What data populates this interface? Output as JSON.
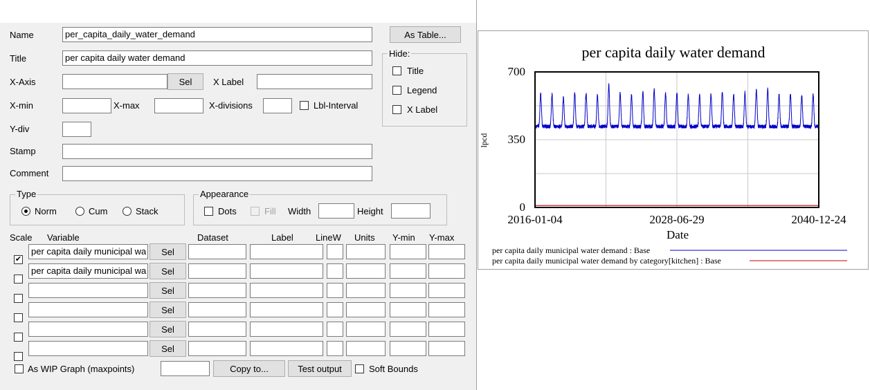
{
  "form": {
    "name_label": "Name",
    "name_value": "per_capita_daily_water_demand",
    "title_label": "Title",
    "title_value": "per capita daily water demand",
    "xaxis_label": "X-Axis",
    "xaxis_value": "",
    "sel_label": "Sel",
    "xlabel_label": "X Label",
    "xlabel_value": "",
    "xmin_label": "X-min",
    "xmin_value": "",
    "xmax_label": "X-max",
    "xmax_value": "",
    "xdiv_label": "X-divisions",
    "xdiv_value": "",
    "lbl_interval_label": "Lbl-Interval",
    "ydiv_label": "Y-div",
    "ydiv_value": "",
    "stamp_label": "Stamp",
    "stamp_value": "",
    "comment_label": "Comment",
    "comment_value": "",
    "as_table_label": "As Table...",
    "hide": {
      "title": "Hide:",
      "options": [
        "Title",
        "Legend",
        "X Label"
      ]
    },
    "type_group": {
      "title": "Type",
      "options": [
        "Norm",
        "Cum",
        "Stack"
      ],
      "selected": "Norm"
    },
    "appearance": {
      "title": "Appearance",
      "dots_label": "Dots",
      "fill_label": "Fill",
      "width_label": "Width",
      "width_value": "",
      "height_label": "Height",
      "height_value": ""
    },
    "columns": [
      "Scale",
      "Variable",
      "Dataset",
      "Label",
      "LineW",
      "Units",
      "Y-min",
      "Y-max"
    ],
    "rows": [
      {
        "checked": true,
        "variable": "per capita daily municipal wa",
        "dataset": "",
        "label": "",
        "linew": "",
        "units": "",
        "ymin": "",
        "ymax": ""
      },
      {
        "checked": false,
        "variable": "per capita daily municipal wa",
        "dataset": "",
        "label": "",
        "linew": "",
        "units": "",
        "ymin": "",
        "ymax": ""
      },
      {
        "checked": false,
        "variable": "",
        "dataset": "",
        "label": "",
        "linew": "",
        "units": "",
        "ymin": "",
        "ymax": ""
      },
      {
        "checked": false,
        "variable": "",
        "dataset": "",
        "label": "",
        "linew": "",
        "units": "",
        "ymin": "",
        "ymax": ""
      },
      {
        "checked": false,
        "variable": "",
        "dataset": "",
        "label": "",
        "linew": "",
        "units": "",
        "ymin": "",
        "ymax": ""
      },
      {
        "checked": false,
        "variable": "",
        "dataset": "",
        "label": "",
        "linew": "",
        "units": "",
        "ymin": "",
        "ymax": ""
      }
    ],
    "wip_label": "As WIP Graph (maxpoints)",
    "wip_value": "",
    "copy_to_label": "Copy to...",
    "test_output_label": "Test output",
    "soft_bounds_label": "Soft Bounds"
  },
  "chart_data": {
    "type": "line",
    "title": "per capita daily water demand",
    "xlabel": "Date",
    "ylabel": "lpcd",
    "x_tick_labels": [
      "2016-01-04",
      "2028-06-29",
      "2040-12-24"
    ],
    "x_range": [
      "2016-01-04",
      "2040-12-24"
    ],
    "ylim": [
      0,
      700
    ],
    "y_ticks": [
      0,
      350,
      700
    ],
    "grid": true,
    "legend_placement": "bottom",
    "series": [
      {
        "name": "per capita daily municipal water demand : Base",
        "color": "#0000c8",
        "pattern": {
          "periods_per_year": 1,
          "base_min": 410,
          "typical_peak": 580,
          "max_peak": 625,
          "years": 25
        },
        "annual_peaks": [
          580,
          575,
          560,
          585,
          580,
          570,
          625,
          580,
          575,
          590,
          600,
          580,
          585,
          575,
          570,
          580,
          590,
          575,
          585,
          600,
          605,
          575,
          580,
          570,
          580
        ]
      },
      {
        "name": "per capita daily municipal water demand by category[kitchen] : Base",
        "color": "#c00000",
        "constant": 10
      }
    ]
  }
}
